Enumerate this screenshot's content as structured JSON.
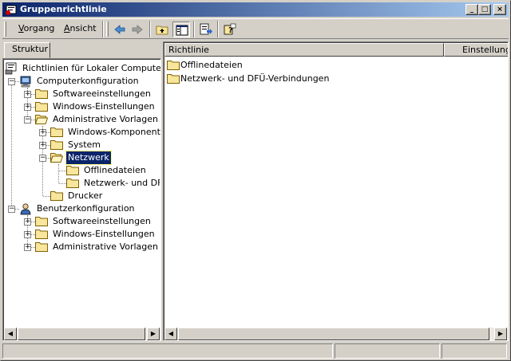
{
  "window": {
    "title": "Gruppenrichtlinie"
  },
  "menu": {
    "vorgang": "Vorgang",
    "vorgang_key": "V",
    "vorgang_rest": "organg",
    "ansicht": "Ansicht",
    "ansicht_key": "A",
    "ansicht_rest": "nsicht"
  },
  "toolbar": {
    "buttons": [
      "back-icon",
      "forward-icon",
      "up-folder-icon",
      "show-hide-tree-icon",
      "export-list-icon",
      "help-icon"
    ],
    "pressed": "show-hide-tree-icon"
  },
  "tabs": {
    "struktur": "Struktur"
  },
  "tree": {
    "root": "Richtlinien für Lokaler Computer",
    "computer": "Computerkonfiguration",
    "c_software": "Softwareeinstellungen",
    "c_windows": "Windows-Einstellungen",
    "c_admin": "Administrative Vorlagen",
    "c_wincomp": "Windows-Komponenten",
    "c_system": "System",
    "c_netzwerk": "Netzwerk",
    "c_offline": "Offlinedateien",
    "c_dfue": "Netzwerk- und DFÜ-",
    "c_drucker": "Drucker",
    "benutzer": "Benutzerkonfiguration",
    "b_software": "Softwareeinstellungen",
    "b_windows": "Windows-Einstellungen",
    "b_admin": "Administrative Vorlagen",
    "selected": "Netzwerk"
  },
  "list": {
    "columns": [
      "Richtlinie",
      "Einstellung"
    ],
    "items": [
      "Offlinedateien",
      "Netzwerk- und DFÜ-Verbindungen"
    ]
  },
  "colors": {
    "titlebar_start": "#0a246a",
    "titlebar_end": "#a6caf0",
    "folder": "#f7e69c",
    "selection": "#0a246a"
  }
}
